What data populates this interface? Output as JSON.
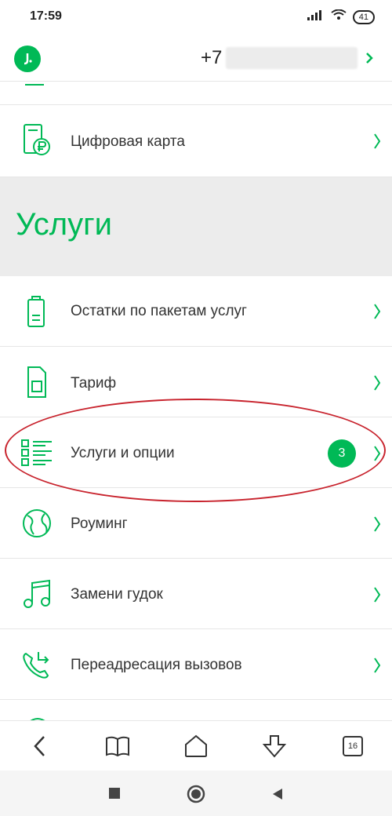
{
  "status": {
    "time": "17:59",
    "battery": "41"
  },
  "header": {
    "phone_prefix": "+7"
  },
  "menu_top": [
    {
      "label": "Цифровая карта",
      "icon": "digital-card-icon"
    }
  ],
  "section": {
    "title": "Услуги"
  },
  "menu": [
    {
      "label": "Остатки по пакетам услуг",
      "icon": "battery-icon"
    },
    {
      "label": "Тариф",
      "icon": "sim-icon"
    },
    {
      "label": "Услуги и опции",
      "icon": "list-icon",
      "badge": "3"
    },
    {
      "label": "Роуминг",
      "icon": "globe-icon"
    },
    {
      "label": "Замени гудок",
      "icon": "music-note-icon"
    },
    {
      "label": "Переадресация вызовов",
      "icon": "call-forward-icon"
    }
  ],
  "browser": {
    "tab_count": "16"
  },
  "colors": {
    "accent": "#00b956",
    "highlight": "#c8232d"
  }
}
